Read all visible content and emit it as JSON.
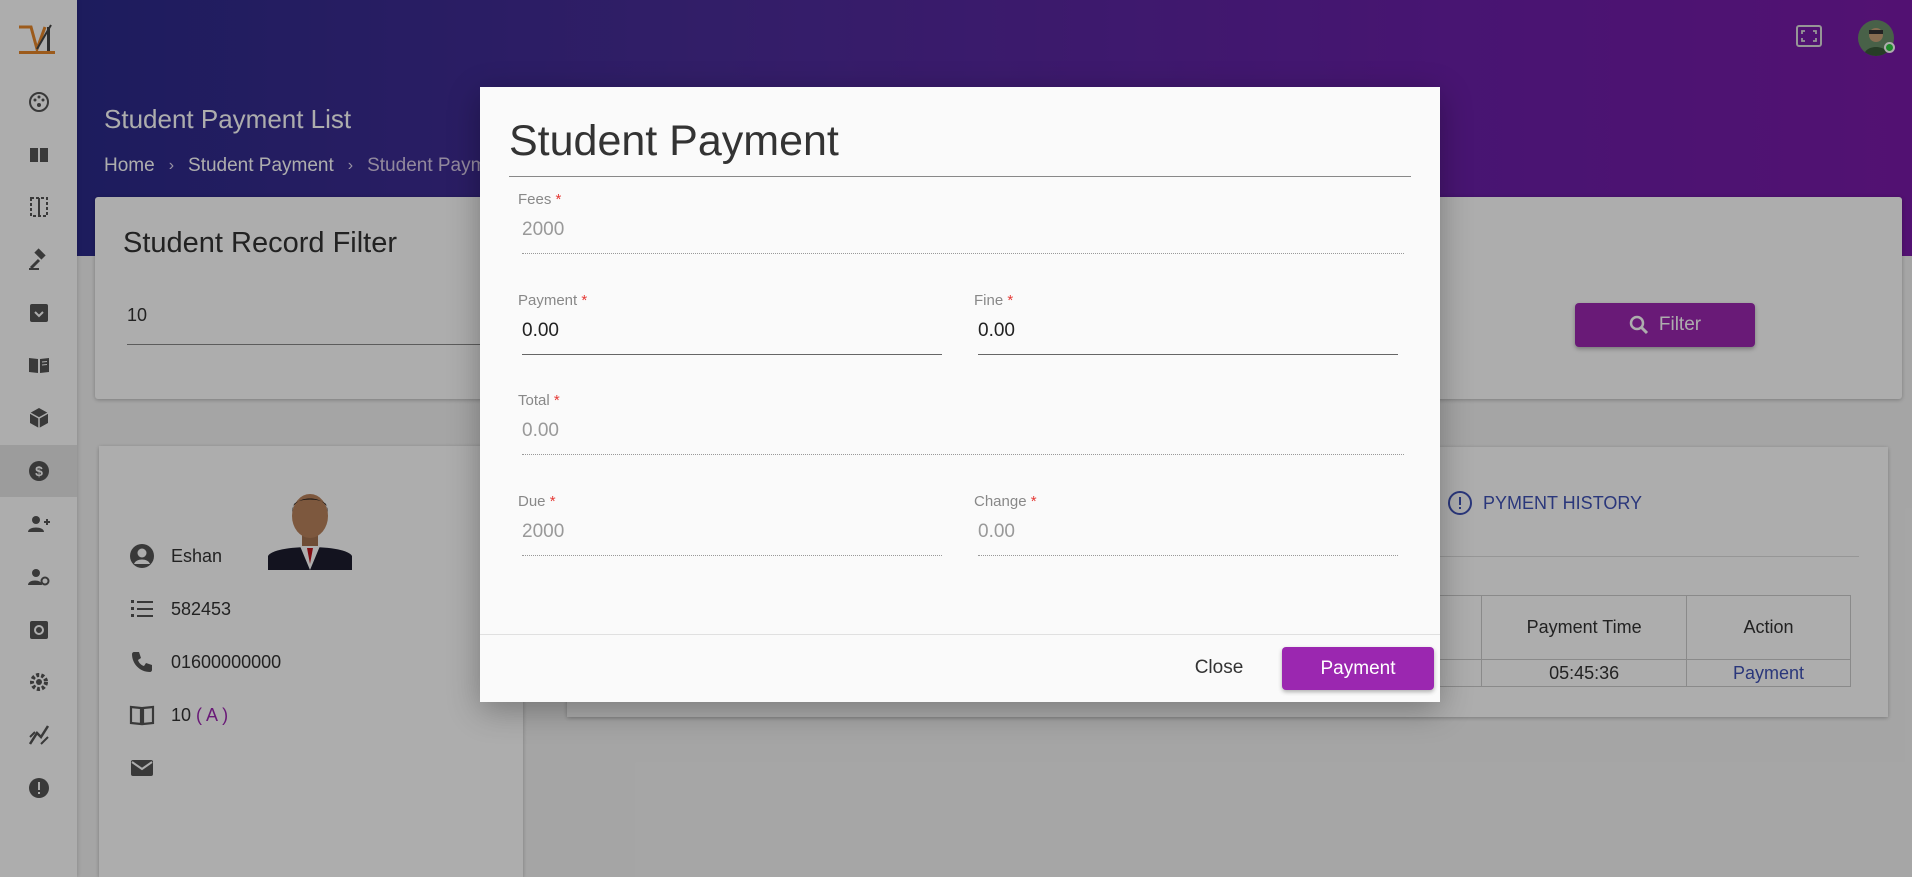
{
  "header": {
    "title": "Student Payment List",
    "breadcrumb": [
      "Home",
      "Student Payment",
      "Student Payment List"
    ],
    "sep": "›"
  },
  "filter": {
    "title": "Student Record Filter",
    "class_value": "10",
    "button_label": "Filter"
  },
  "profile": {
    "name": "Eshan",
    "id": "582453",
    "phone": "01600000000",
    "class": "10",
    "section": "( A )"
  },
  "history": {
    "tab_label": "PYMENT HISTORY",
    "columns": [
      "Payment Time",
      "Action"
    ],
    "rows": [
      {
        "time": "05:45:36",
        "action": "Payment"
      }
    ]
  },
  "dialog": {
    "title": "Student Payment",
    "fields": {
      "fees": {
        "label": "Fees",
        "value": "2000"
      },
      "payment": {
        "label": "Payment",
        "value": "0.00"
      },
      "fine": {
        "label": "Fine",
        "value": "0.00"
      },
      "total": {
        "label": "Total",
        "value": "0.00"
      },
      "due": {
        "label": "Due",
        "value": "2000"
      },
      "change": {
        "label": "Change",
        "value": "0.00"
      }
    },
    "required_mark": "*",
    "close_label": "Close",
    "payment_label": "Payment"
  },
  "colors": {
    "accent": "#9b27b0",
    "header_start": "#2b2a8a",
    "header_end": "#7a1aa8",
    "link": "#3f51b5"
  },
  "icons": [
    "dashboard-icon",
    "book-icon",
    "grid-icon",
    "gavel-icon",
    "inbox-icon",
    "library-icon",
    "cube-icon",
    "dollar-icon",
    "add-user-icon",
    "user-settings-icon",
    "settings-box-icon",
    "gear-icon",
    "chart-icon",
    "alert-icon"
  ]
}
